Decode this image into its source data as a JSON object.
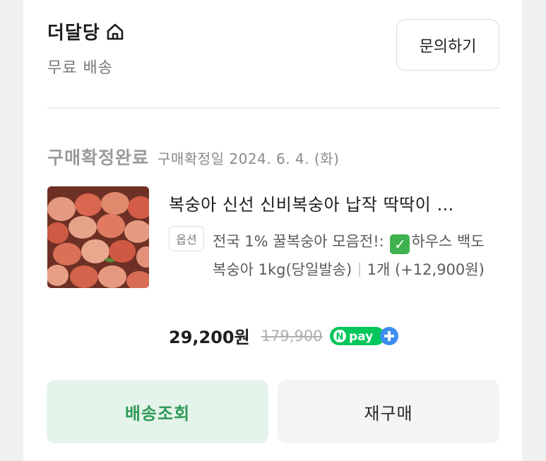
{
  "store": {
    "name": "더달당",
    "shipping": "무료 배송",
    "inquiry_label": "문의하기"
  },
  "order": {
    "status": "구매확정완료",
    "confirm_date": "구매확정일 2024. 6. 4. (화)",
    "product": {
      "title": "복숭아 신선 신비복숭아 납작 딱딱이 …",
      "option_badge": "옵션",
      "option_part1": "전국 1% 꿀복숭아 모음전!:",
      "option_part2": "하우스 백도 복숭아 1kg(당일발송)",
      "quantity_extra": "1개 (+12,900원)",
      "price": "29,200원",
      "original_price": "179,900",
      "npay_label": "pay"
    }
  },
  "actions": {
    "track_label": "배송조회",
    "reorder_label": "재구매"
  },
  "colors": {
    "accent_green": "#2f9a58",
    "npay_green": "#03c75a",
    "npay_plus_blue": "#3d8ef0"
  }
}
